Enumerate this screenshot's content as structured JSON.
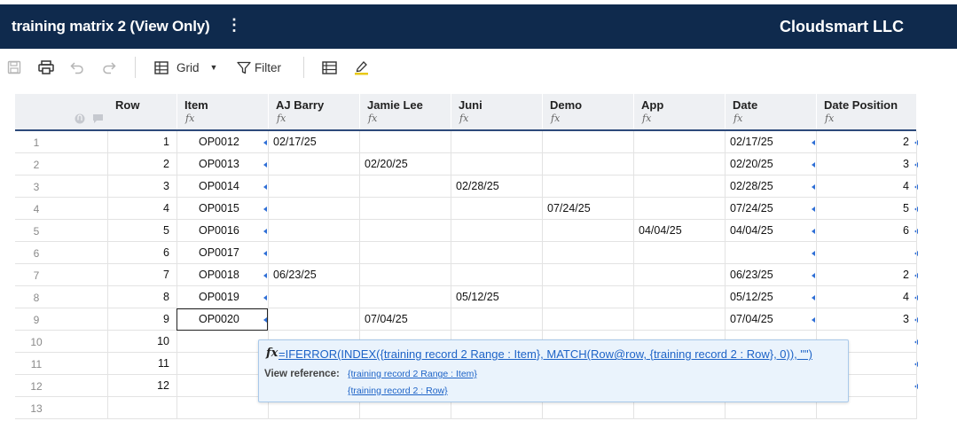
{
  "header": {
    "sheet_title": "training matrix 2 (View Only)",
    "menu_glyph": "⋮",
    "company": "Cloudsmart LLC"
  },
  "toolbar": {
    "grid_label": "Grid",
    "filter_label": "Filter",
    "icons": [
      "save-icon",
      "print-icon",
      "undo-icon",
      "redo-icon",
      "grid-view-icon",
      "chevron-down-icon",
      "filter-icon",
      "card-view-icon",
      "highlight-icon"
    ]
  },
  "columns": [
    {
      "name": "Row",
      "fx": ""
    },
    {
      "name": "Item",
      "fx": "fx"
    },
    {
      "name": "AJ Barry",
      "fx": "fx"
    },
    {
      "name": "Jamie Lee",
      "fx": "fx"
    },
    {
      "name": "Juni",
      "fx": "fx"
    },
    {
      "name": "Demo",
      "fx": "fx"
    },
    {
      "name": "App",
      "fx": "fx"
    },
    {
      "name": "Date",
      "fx": "fx"
    },
    {
      "name": "Date Position",
      "fx": "fx"
    }
  ],
  "header_icons": [
    "attachment-icon",
    "comment-icon"
  ],
  "rows": [
    {
      "num": "1",
      "row": "1",
      "item": "OP0012",
      "aj": "02/17/25",
      "jamie": "",
      "juni": "",
      "demo": "",
      "app": "",
      "date": "02/17/25",
      "pos": "2"
    },
    {
      "num": "2",
      "row": "2",
      "item": "OP0013",
      "aj": "",
      "jamie": "02/20/25",
      "juni": "",
      "demo": "",
      "app": "",
      "date": "02/20/25",
      "pos": "3"
    },
    {
      "num": "3",
      "row": "3",
      "item": "OP0014",
      "aj": "",
      "jamie": "",
      "juni": "02/28/25",
      "demo": "",
      "app": "",
      "date": "02/28/25",
      "pos": "4"
    },
    {
      "num": "4",
      "row": "4",
      "item": "OP0015",
      "aj": "",
      "jamie": "",
      "juni": "",
      "demo": "07/24/25",
      "app": "",
      "date": "07/24/25",
      "pos": "5"
    },
    {
      "num": "5",
      "row": "5",
      "item": "OP0016",
      "aj": "",
      "jamie": "",
      "juni": "",
      "demo": "",
      "app": "04/04/25",
      "date": "04/04/25",
      "pos": "6"
    },
    {
      "num": "6",
      "row": "6",
      "item": "OP0017",
      "aj": "",
      "jamie": "",
      "juni": "",
      "demo": "",
      "app": "",
      "date": "",
      "pos": ""
    },
    {
      "num": "7",
      "row": "7",
      "item": "OP0018",
      "aj": "06/23/25",
      "jamie": "",
      "juni": "",
      "demo": "",
      "app": "",
      "date": "06/23/25",
      "pos": "2"
    },
    {
      "num": "8",
      "row": "8",
      "item": "OP0019",
      "aj": "",
      "jamie": "",
      "juni": "05/12/25",
      "demo": "",
      "app": "",
      "date": "05/12/25",
      "pos": "4"
    },
    {
      "num": "9",
      "row": "9",
      "item": "OP0020",
      "aj": "",
      "jamie": "07/04/25",
      "juni": "",
      "demo": "",
      "app": "",
      "date": "07/04/25",
      "pos": "3"
    },
    {
      "num": "10",
      "row": "10",
      "item": "",
      "aj": "",
      "jamie": "",
      "juni": "",
      "demo": "",
      "app": "",
      "date": "",
      "pos": ""
    },
    {
      "num": "11",
      "row": "11",
      "item": "",
      "aj": "",
      "jamie": "",
      "juni": "",
      "demo": "",
      "app": "",
      "date": "",
      "pos": ""
    },
    {
      "num": "12",
      "row": "12",
      "item": "",
      "aj": "",
      "jamie": "",
      "juni": "",
      "demo": "",
      "app": "",
      "date": "",
      "pos": ""
    },
    {
      "num": "13",
      "row": "",
      "item": "",
      "aj": "",
      "jamie": "",
      "juni": "",
      "demo": "",
      "app": "",
      "date": "",
      "pos": ""
    }
  ],
  "tooltip": {
    "fx_glyph": "fx",
    "formula": "=IFERROR(INDEX({training record 2 Range : Item}, MATCH(Row@row, {training record 2 : Row}, 0)), \"\")",
    "view_reference_label": "View reference:",
    "references": [
      "{training record 2 Range : Item}",
      "{training record 2 : Row}"
    ]
  },
  "colors": {
    "header_bg": "#0f2a4d",
    "link": "#1d63c7",
    "marker": "#2f6fd6",
    "tooltip_bg": "#eaf3fc"
  }
}
